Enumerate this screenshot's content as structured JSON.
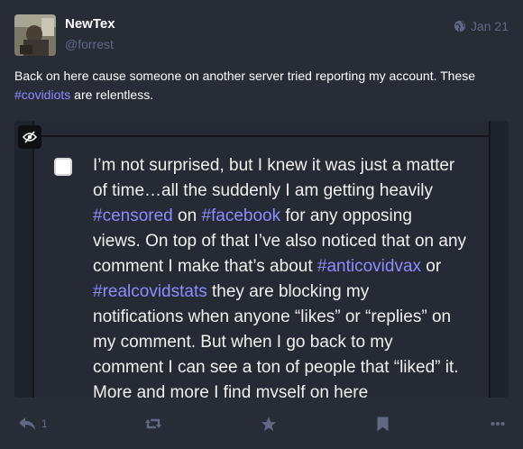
{
  "status": {
    "display_name": "NewTex",
    "account": "@forrest",
    "visibility_icon": "globe-icon",
    "date": "Jan 21",
    "content": {
      "part1": "Back on here cause someone on another server tried reporting my account. These ",
      "hashtag": "#covidiots",
      "part2": " are relentless."
    },
    "media": {
      "spoiler_icon": "eye-slash-icon",
      "lines": [
        [
          "I’m not surprised, but I knew it was just a matter"
        ],
        [
          "of time…all the suddenly I am getting heavily"
        ],
        [
          {
            "tag": "#censored"
          },
          " on ",
          {
            "tag": "#facebook"
          },
          " for any opposing"
        ],
        [
          "views. On top of that I’ve also noticed that on any"
        ],
        [
          "comment I make that’s about ",
          {
            "tag": "#anticovidvax"
          },
          " or"
        ],
        [
          {
            "tag": "#realcovidstats"
          },
          " they are blocking my"
        ],
        [
          "notifications when anyone “likes” or “replies” on"
        ],
        [
          "my comment. But when I go back to my"
        ],
        [
          "comment I can see a ton of people that “liked” it."
        ],
        [
          "More and more I find myself on here"
        ]
      ]
    },
    "actions": {
      "reply_count": "1",
      "reply_icon": "reply-icon",
      "boost_icon": "retweet-icon",
      "favourite_icon": "star-icon",
      "bookmark_icon": "bookmark-icon",
      "more_icon": "ellipsis-icon"
    }
  },
  "colors": {
    "background": "#282c37",
    "muted": "#606984",
    "hashtag": "#8c8dff",
    "text": "#ffffff"
  }
}
